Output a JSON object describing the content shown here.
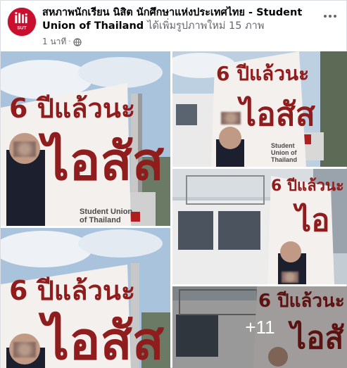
{
  "post": {
    "page_name": "สหภาพนักเรียน นิสิต นักศึกษาแห่งประเทศไทย - Student Union of Thailand",
    "action": "ได้เพิ่มรูปภาพใหม่ 15 ภาพ",
    "timestamp": "1 นาที",
    "separator": "·",
    "privacy_icon": "globe-icon",
    "more_icon": "more-options-icon"
  },
  "avatar": {
    "brand_color": "#c8102e",
    "logo_text": "SUT"
  },
  "photos": [
    {
      "banner_line1": "6 ปีแล้วนะ",
      "banner_line2": "ไอสัส",
      "logo": "Student Union of Thailand"
    },
    {
      "banner_line1": "6 ปีแล้วนะ",
      "banner_line2": "ไอสัส",
      "logo": "Student Union of Thailand"
    },
    {
      "banner_line1": "6 ปีแล้วนะ",
      "banner_line2": "ไอ"
    },
    {
      "banner_line1": "6 ปีแล้วนะ",
      "banner_line2": "ไอสัส"
    },
    {
      "banner_line1": "6 ปีแล้วนะ",
      "banner_line2": "ไอสั"
    }
  ],
  "more_photos_label": "+11",
  "colors": {
    "banner_text": "#8f1d1d",
    "sky": "#a9c3dc",
    "truck": "#e7e7e7"
  }
}
